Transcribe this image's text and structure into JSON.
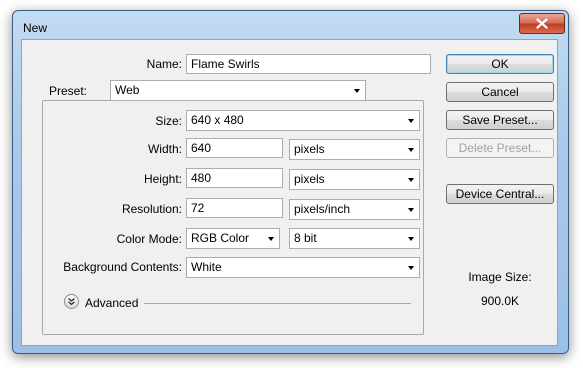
{
  "window": {
    "title": "New"
  },
  "name": {
    "label": "Name:",
    "value": "Flame Swirls"
  },
  "preset": {
    "label": "Preset:",
    "value": "Web"
  },
  "size": {
    "label": "Size:",
    "value": "640 x 480"
  },
  "width": {
    "label": "Width:",
    "value": "640",
    "unit": "pixels"
  },
  "height": {
    "label": "Height:",
    "value": "480",
    "unit": "pixels"
  },
  "resolution": {
    "label": "Resolution:",
    "value": "72",
    "unit": "pixels/inch"
  },
  "color_mode": {
    "label": "Color Mode:",
    "value": "RGB Color",
    "depth": "8 bit"
  },
  "background": {
    "label": "Background Contents:",
    "value": "White"
  },
  "advanced": {
    "label": "Advanced"
  },
  "buttons": {
    "ok": "OK",
    "cancel": "Cancel",
    "save_preset": "Save Preset...",
    "delete_preset": "Delete Preset...",
    "device_central": "Device Central..."
  },
  "image_size": {
    "label": "Image Size:",
    "value": "900.0K"
  },
  "colors": {
    "frame": "#a8c9ea",
    "client": "#f0f0f0",
    "close": "#c8452a"
  },
  "icons": {
    "close": "close-icon",
    "advanced": "chevron-double-down-icon"
  }
}
